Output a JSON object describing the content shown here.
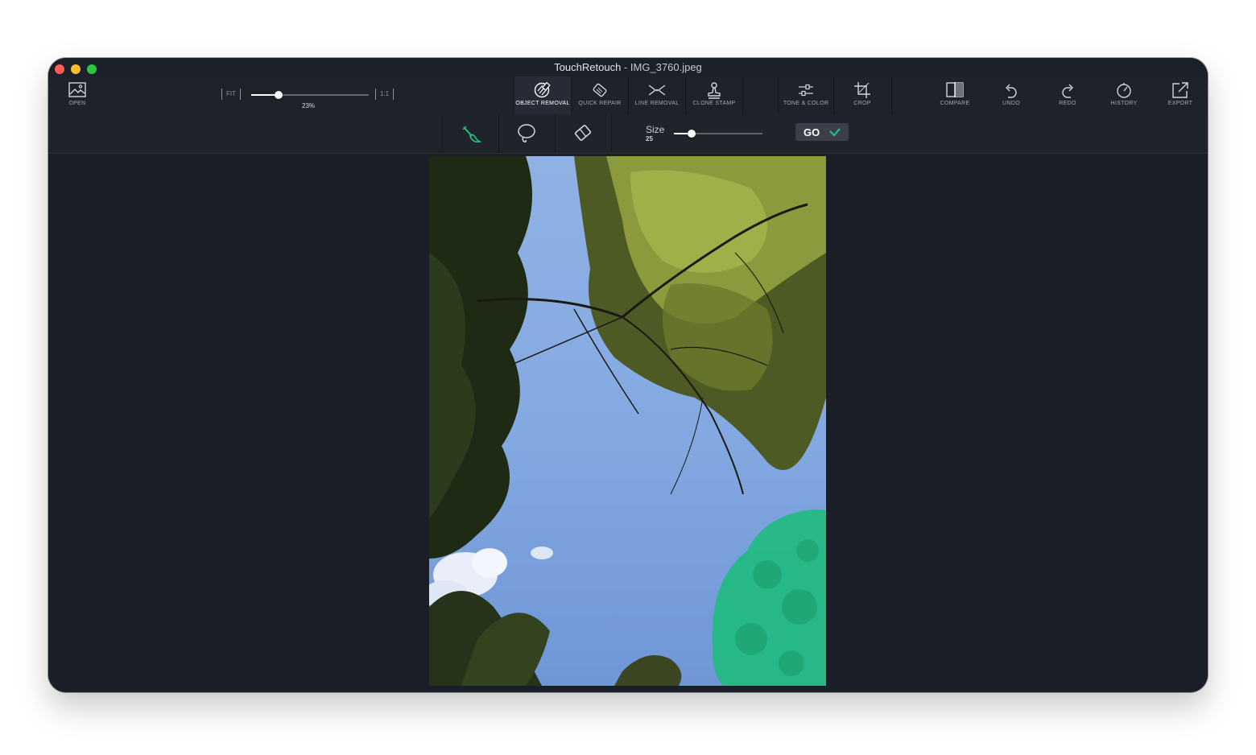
{
  "window": {
    "app_name": "TouchRetouch",
    "separator": " - ",
    "file_name": "IMG_3760.jpeg"
  },
  "toolbar": {
    "open_label": "OPEN",
    "zoom": {
      "fit_label": "FIT",
      "one_to_one_label": "1:1",
      "percent_label": "23%",
      "value_percent": 23
    },
    "tools": [
      {
        "label": "OBJECT REMOVAL",
        "icon": "object-removal-icon",
        "active": true
      },
      {
        "label": "QUICK REPAIR",
        "icon": "quick-repair-icon",
        "active": false
      },
      {
        "label": "LINE REMOVAL",
        "icon": "line-removal-icon",
        "active": false
      },
      {
        "label": "CLONE STAMP",
        "icon": "clone-stamp-icon",
        "active": false
      },
      {
        "label": "TONE & COLOR",
        "icon": "tone-color-icon",
        "active": false
      },
      {
        "label": "CROP",
        "icon": "crop-icon",
        "active": false
      }
    ],
    "actions": [
      {
        "label": "COMPARE",
        "icon": "compare-icon"
      },
      {
        "label": "UNDO",
        "icon": "undo-icon"
      },
      {
        "label": "REDO",
        "icon": "redo-icon"
      },
      {
        "label": "HISTORY",
        "icon": "history-icon"
      },
      {
        "label": "EXPORT",
        "icon": "export-icon"
      }
    ]
  },
  "subtoolbar": {
    "tools": [
      {
        "name": "brush",
        "icon": "brush-icon",
        "active": true
      },
      {
        "name": "lasso",
        "icon": "lasso-icon",
        "active": false
      },
      {
        "name": "eraser",
        "icon": "eraser-icon",
        "active": false
      }
    ],
    "size_label": "Size",
    "size_value": "25",
    "size_fraction": 0.2,
    "go_label": "GO"
  },
  "colors": {
    "accent": "#22c27a",
    "mask": "#1fbb7f",
    "window_bg": "#1a1e27",
    "toolbar_bg": "#1e222b"
  },
  "canvas": {
    "image": "upward view of tree canopy against blue sky",
    "mask_region": "bottom-right tree highlighted in green"
  }
}
